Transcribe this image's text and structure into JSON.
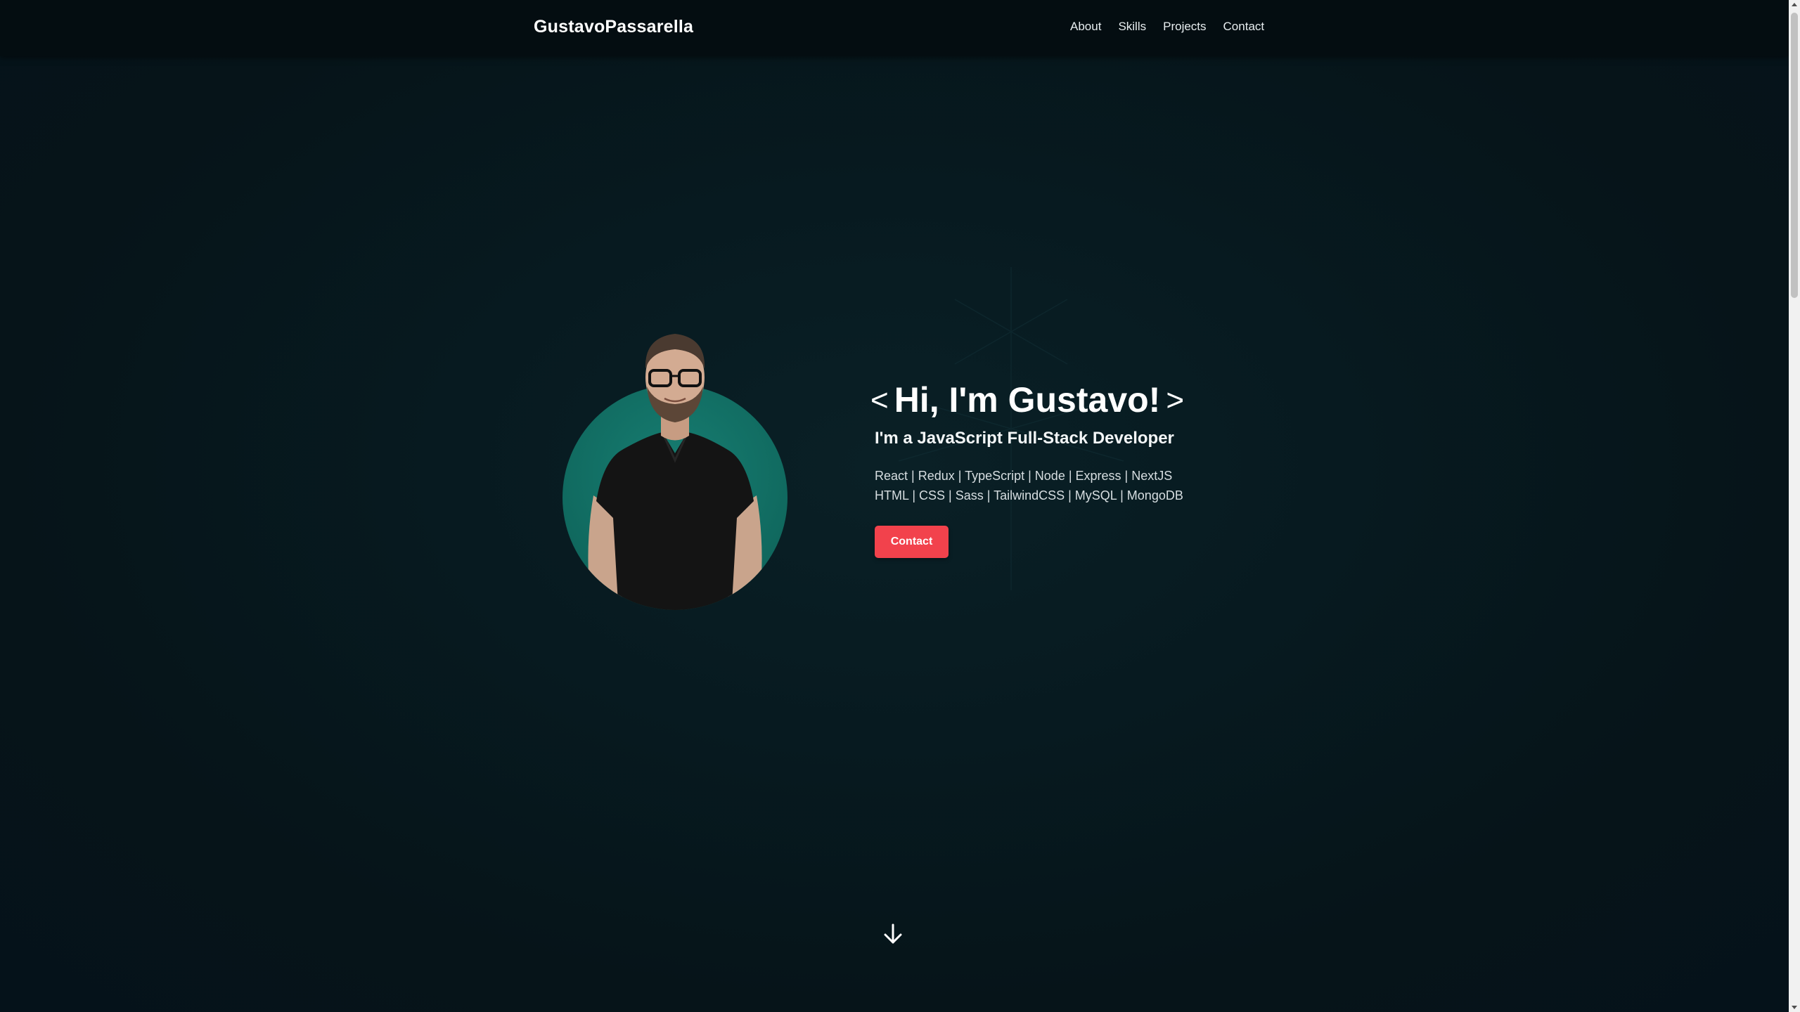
{
  "navbar": {
    "brand": "GustavoPassarella",
    "links": [
      "About",
      "Skills",
      "Projects",
      "Contact"
    ]
  },
  "hero": {
    "title": "Hi, I'm Gustavo!",
    "bracket_left": "<",
    "bracket_right": ">",
    "subtitle": "I'm a JavaScript Full-Stack Developer",
    "skills_line_1": "React | Redux | TypeScript | Node | Express | NextJS",
    "skills_line_2": "HTML | CSS | Sass | TailwindCSS | MySQL | MongoDB",
    "contact_button": "Contact"
  },
  "icons": {
    "scroll_down": "arrow-down-icon",
    "avatar": "profile-photo"
  },
  "colors": {
    "background": "#061318",
    "navbar": "#040d11",
    "accent_circle": "#12766a",
    "button": "#f2424c",
    "text": "#ffffff"
  }
}
